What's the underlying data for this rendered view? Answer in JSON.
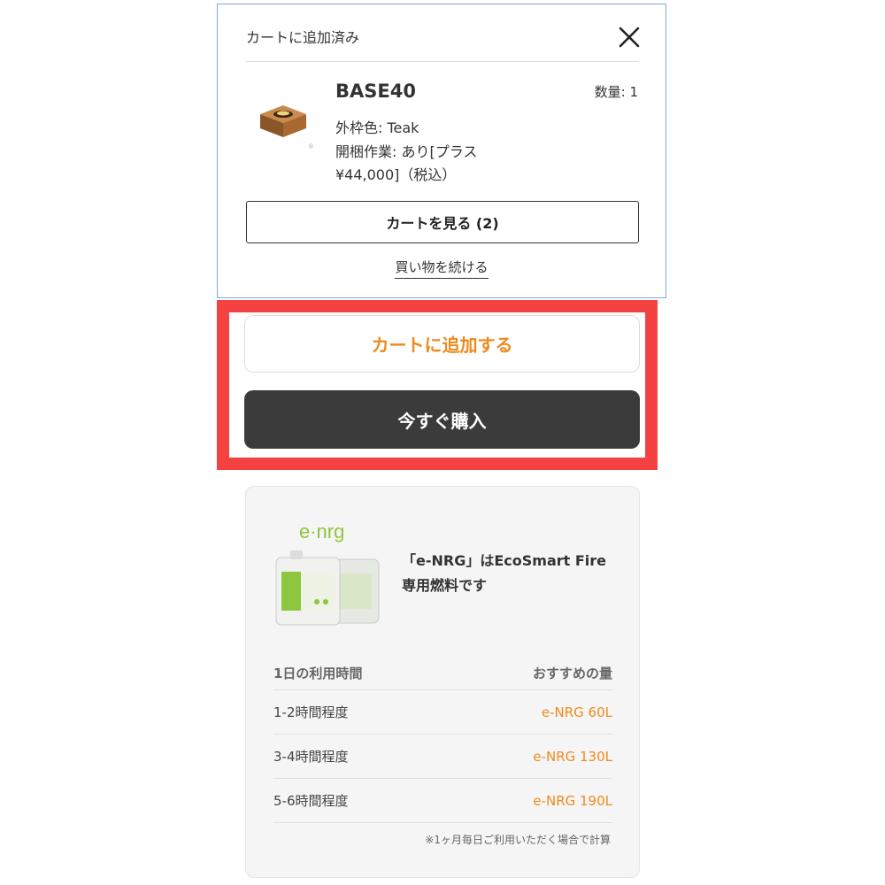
{
  "popup": {
    "title": "カートに追加済み",
    "product_name": "BASE40",
    "quantity": "数量: 1",
    "variant": "外枠色: Teak",
    "option": "開梱作業: あり[プラス ¥44,000]（税込）",
    "view_cart_label": "カートを見る (2)",
    "continue_label": "買い物を続ける"
  },
  "actions": {
    "add_to_cart_label": "カートに追加する",
    "buy_now_label": "今すぐ購入"
  },
  "fuel": {
    "logo_text": "e·nrg",
    "heading": "「e-NRG」はEcoSmart Fire 専用燃料です",
    "table_header": {
      "left": "1日の利用時間",
      "right": "おすすめの量"
    },
    "rows": [
      {
        "time": "1-2時間程度",
        "amount": "e-NRG 60L"
      },
      {
        "time": "3-4時間程度",
        "amount": "e-NRG 130L"
      },
      {
        "time": "5-6時間程度",
        "amount": "e-NRG 190L"
      }
    ],
    "footnote": "※1ヶ月毎日ご利用いただく場合で計算"
  },
  "colors": {
    "accent": "#ee8a1e",
    "highlight": "#f44243",
    "dark_button": "#3b3b3b",
    "logo_green": "#8dc63f"
  }
}
